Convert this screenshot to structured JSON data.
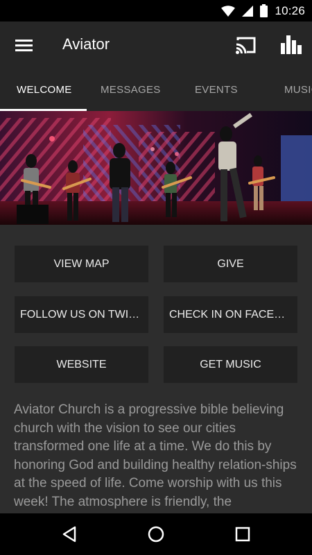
{
  "status_bar": {
    "time": "10:26"
  },
  "app_bar": {
    "title": "Aviator"
  },
  "tabs": [
    {
      "label": "WELCOME",
      "active": true
    },
    {
      "label": "MESSAGES",
      "active": false
    },
    {
      "label": "EVENTS",
      "active": false
    },
    {
      "label": "MUSIC",
      "active": false
    }
  ],
  "buttons": {
    "view_map": "VIEW MAP",
    "give": "GIVE",
    "follow_twitter": "FOLLOW US ON TWITTER",
    "check_in_facebook": "CHECK IN ON FACEBOOK",
    "website": "WEBSITE",
    "get_music": "GET MUSIC"
  },
  "description": "Aviator Church is a progressive bible believing church with the vision to see our cities transformed one life at a time. We do this by honoring God and building healthy relation-ships at the speed of life. Come worship with us this week! The atmosphere is friendly, the",
  "colors": {
    "app_bar": "#262626",
    "content_bg": "#2d2d2d",
    "button_bg": "#212121",
    "body_text": "#9a9a9a"
  },
  "icons": {
    "menu": "menu-icon",
    "cast": "cast-icon",
    "stats": "bar-chart-icon",
    "back": "back-triangle-icon",
    "home": "home-circle-icon",
    "recents": "recents-square-icon"
  }
}
